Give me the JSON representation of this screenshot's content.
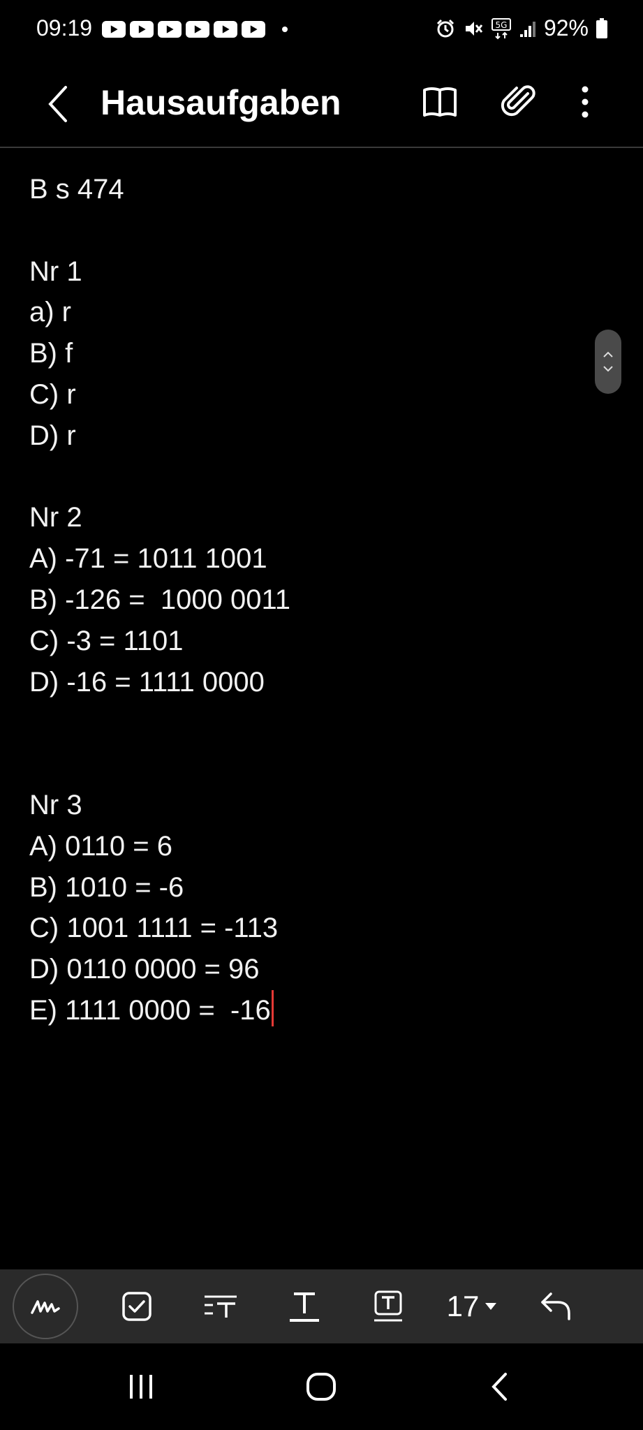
{
  "status_bar": {
    "time": "09:19",
    "notification_icons": [
      "youtube-icon",
      "youtube-icon",
      "youtube-icon",
      "youtube-icon",
      "youtube-icon",
      "youtube-icon"
    ],
    "network": "5G",
    "battery": "92%"
  },
  "app_bar": {
    "title": "Hausaufgaben"
  },
  "note": {
    "lines": [
      "B s 474",
      "",
      "Nr 1",
      "a) r",
      "B) f",
      "C) r",
      "D) r",
      "",
      "Nr 2",
      "A) -71 = 1011 1001",
      "B) -126 =  1000 0011",
      "C) -3 = 1101",
      "D) -16 = 1111 0000",
      "",
      "",
      "Nr 3",
      "A) 0110 = 6",
      "B) 1010 = -6",
      "C) 1001 1111 = -113",
      "D) 0110 0000 = 96",
      "E) 1111 0000 =  -16"
    ]
  },
  "toolbar": {
    "font_size": "17"
  },
  "colors": {
    "background": "#000000",
    "toolbar": "#2a2a2a",
    "cursor": "#e53935"
  }
}
